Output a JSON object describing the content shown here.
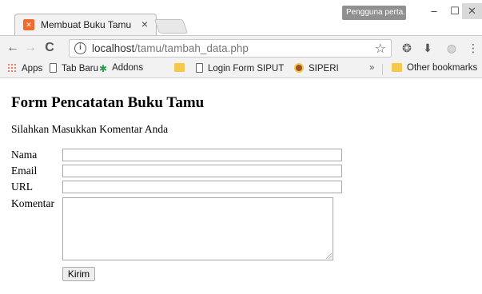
{
  "browser": {
    "tab_title": "Membuat Buku Tamu",
    "tab_close": "×",
    "user_badge": "Pengguna perta...",
    "window_min": "–",
    "window_max": "☐",
    "window_close": "✕",
    "url_host": "localhost",
    "url_path": "/tamu/tambah_data.php",
    "info_glyph": "i"
  },
  "bookmarks": {
    "apps": "Apps",
    "tab_baru": "Tab Baru",
    "addons": "Addons",
    "login_form": "Login Form SIPUT",
    "siperi": "SIPERI",
    "more": "»",
    "other": "Other bookmarks"
  },
  "page": {
    "title": "Form Pencatatan Buku Tamu",
    "subtitle": "Silahkan Masukkan Komentar Anda",
    "labels": {
      "nama": "Nama",
      "email": "Email",
      "url": "URL",
      "komentar": "Komentar"
    },
    "fields": {
      "nama": "",
      "email": "",
      "url": "",
      "komentar": ""
    },
    "submit_label": "Kirim"
  },
  "icons": {
    "favicon": "xampp-icon",
    "back": "arrow-left-icon",
    "forward": "arrow-right-icon",
    "reload": "reload-icon",
    "star": "star-icon",
    "menu": "kebab-menu-icon"
  },
  "colors": {
    "favicon": "#f26b2c",
    "user_badge": "#909090",
    "chrome_bg": "#f2f2f2"
  }
}
